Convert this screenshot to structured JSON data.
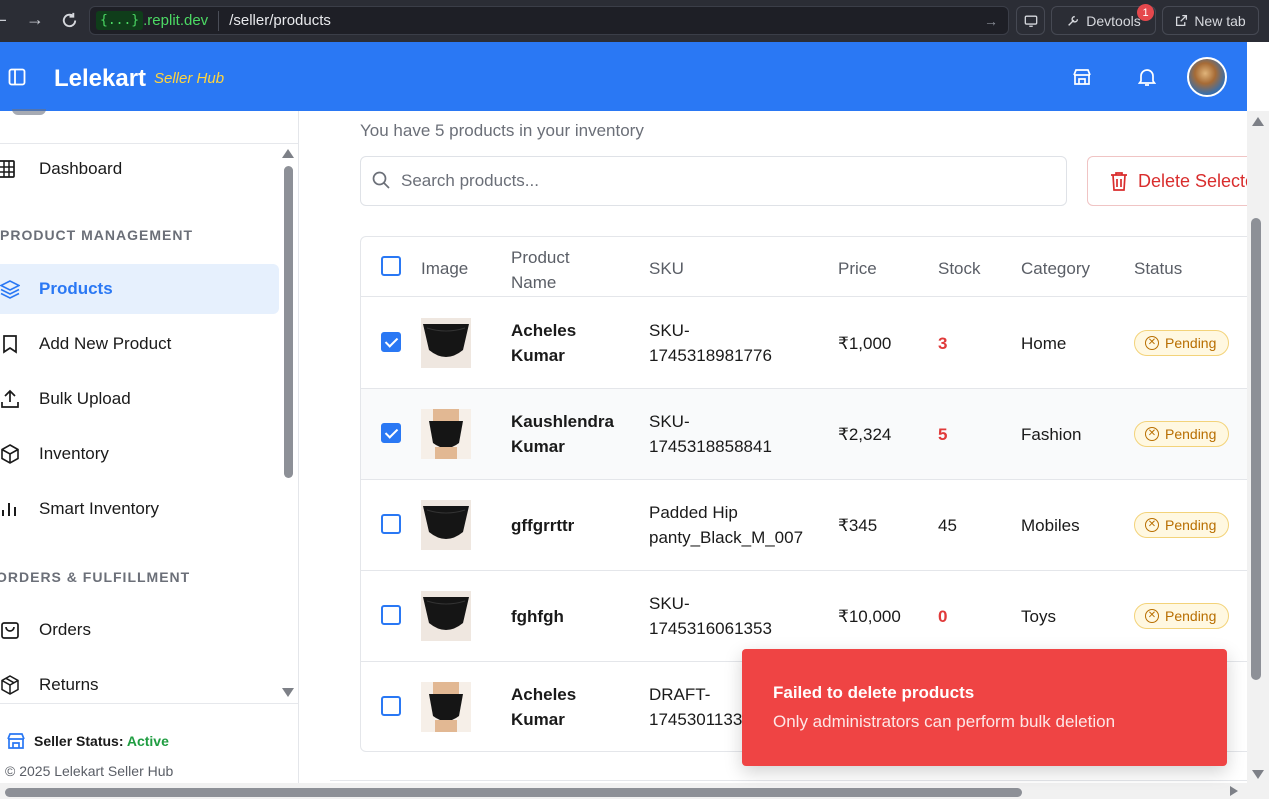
{
  "browser": {
    "replit_badge": "{...}",
    "host": ".replit.dev",
    "path": "/seller/products",
    "devtools_label": "Devtools",
    "devtools_count": "1",
    "newtab_label": "New tab"
  },
  "header": {
    "brand": "Lelekart",
    "brand_sub": "Seller Hub"
  },
  "sidebar": {
    "items": [
      {
        "label": "Dashboard",
        "icon": "grid-icon"
      },
      {
        "label": "Products",
        "icon": "layers-icon"
      },
      {
        "label": "Add New Product",
        "icon": "bookmark-icon"
      },
      {
        "label": "Bulk Upload",
        "icon": "upload-icon"
      },
      {
        "label": "Inventory",
        "icon": "box-icon"
      },
      {
        "label": "Smart Inventory",
        "icon": "bar-chart-icon"
      },
      {
        "label": "Orders",
        "icon": "bag-icon"
      },
      {
        "label": "Returns",
        "icon": "package-icon"
      }
    ],
    "sections": {
      "product_management": "PRODUCT MANAGEMENT",
      "orders_fulfillment": "ORDERS & FULFILLMENT"
    },
    "seller_status_label": "Seller Status:",
    "seller_status_value": "Active",
    "copyright": "© 2025 Lelekart Seller Hub"
  },
  "main": {
    "inventory_text": "You have 5 products in your inventory",
    "search_placeholder": "Search products...",
    "delete_button": "Delete Selected",
    "columns": [
      "Image",
      "Product Name",
      "SKU",
      "Price",
      "Stock",
      "Category",
      "Status"
    ],
    "columns_display": {
      "name_line1": "Product",
      "name_line2": "Name"
    },
    "rows": [
      {
        "checked": true,
        "name1": "Acheles",
        "name2": "Kumar",
        "sku1": "SKU-",
        "sku2": "1745318981776",
        "price": "₹1,000",
        "stock": "3",
        "low": true,
        "category": "Home",
        "status": "Pending"
      },
      {
        "checked": true,
        "name1": "Kaushlendra",
        "name2": "Kumar",
        "sku1": "SKU-",
        "sku2": "1745318858841",
        "price": "₹2,324",
        "stock": "5",
        "low": true,
        "category": "Fashion",
        "status": "Pending"
      },
      {
        "checked": false,
        "name1": "gffgrrttr",
        "name2": "",
        "sku1": "Padded Hip",
        "sku2": "panty_Black_M_007",
        "price": "₹345",
        "stock": "45",
        "low": false,
        "category": "Mobiles",
        "status": "Pending"
      },
      {
        "checked": false,
        "name1": "fghfgh",
        "name2": "",
        "sku1": "SKU-",
        "sku2": "1745316061353",
        "price": "₹10,000",
        "stock": "0",
        "low": true,
        "category": "Toys",
        "status": "Pending"
      },
      {
        "checked": false,
        "name1": "Acheles",
        "name2": "Kumar",
        "sku1": "DRAFT-",
        "sku2": "1745301133",
        "price": "",
        "stock": "",
        "low": false,
        "category": "",
        "status": ""
      }
    ]
  },
  "toast": {
    "title": "Failed to delete products",
    "message": "Only administrators can perform bulk deletion"
  },
  "colors": {
    "primary": "#2a78f4",
    "danger": "#ef4444",
    "brand_sub": "#ffd53d",
    "active_status": "#1f9d41"
  }
}
